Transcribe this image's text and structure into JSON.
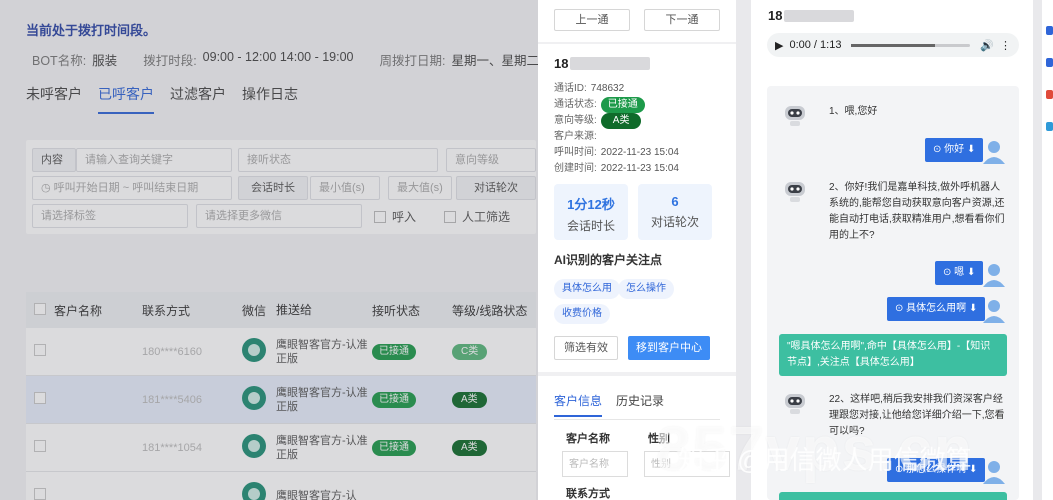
{
  "background": {
    "notice": "当前处于拨打时间段。",
    "meta": [
      {
        "k": "BOT名称:",
        "v": "服装"
      },
      {
        "k": "拨打时段:",
        "v": "09:00 - 12:00 14:00 - 19:00"
      },
      {
        "k": "周拨打日期:",
        "v": "星期一、星期二、星期三"
      }
    ],
    "tabs": [
      "未呼客户",
      "已呼客户",
      "过滤客户",
      "操作日志"
    ],
    "filters": {
      "content_label": "内容",
      "keyword_placeholder": "请输入查询关键字",
      "status_placeholder": "接听状态",
      "intent_placeholder": "意向等级",
      "start_date": "呼叫开始日期",
      "end_date": "呼叫结束日期",
      "duration_label": "会话时长",
      "min_placeholder": "最小值(s)",
      "max_placeholder": "最大值(s)",
      "rounds_label": "对话轮次",
      "tag_placeholder": "请选择标签",
      "wechat_placeholder": "请选择更多微信",
      "inbound_label": "呼入",
      "manual_label": "人工筛选"
    },
    "columns": [
      "客户名称",
      "联系方式",
      "微信",
      "推送给",
      "接听状态",
      "等级/线路状态"
    ],
    "rows": [
      {
        "phone": "180****6160",
        "push": "鹰眼智客官方-认准正版",
        "status": "已接通",
        "level": "C类"
      },
      {
        "phone": "181****5406",
        "push": "鹰眼智客官方-认准正版",
        "status": "已接通",
        "level": "A类"
      },
      {
        "phone": "181****1054",
        "push": "鹰眼智客官方-认准正版",
        "status": "已接通",
        "level": "A类"
      },
      {
        "phone": "",
        "push": "鹰眼智客官方-认",
        "status": "",
        "level": ""
      }
    ]
  },
  "detail": {
    "prev": "上一通",
    "next": "下一通",
    "phone_prefix": "18",
    "call_id_label": "通话ID:",
    "call_id": "748632",
    "call_status_label": "通话状态:",
    "call_status": "已接通",
    "intent_label": "意向等级:",
    "intent": "A类",
    "source_label": "客户来源:",
    "call_time_label": "呼叫时间:",
    "call_time": "2022-11-23 15:04",
    "create_time_label": "创建时间:",
    "create_time": "2022-11-23 15:04",
    "duration_value": "1分12秒",
    "duration_label": "会话时长",
    "rounds_value": "6",
    "rounds_label": "对话轮次",
    "ai_title": "AI识别的客户关注点",
    "tags": [
      "具体怎么用",
      "怎么操作",
      "收费价格"
    ],
    "filter_btn": "筛选有效",
    "move_btn": "移到客户中心",
    "tabs": [
      "客户信息",
      "历史记录"
    ],
    "name_label": "客户名称",
    "name_placeholder": "客户名称",
    "gender_label": "性别",
    "gender_placeholder": "性别",
    "contact_label": "联系方式"
  },
  "conversation": {
    "phone_prefix": "18",
    "audio_time": "0:00 / 1:13",
    "messages": [
      {
        "role": "bot",
        "text": "1、喂,您好"
      },
      {
        "role": "user",
        "text": "你好"
      },
      {
        "role": "bot",
        "text": "2、你好!我们是嘉单科技,做外呼机器人系统的,能帮您自动获取意向客户资源,还能自动打电话,获取精准用户,想看看你们用的上不?"
      },
      {
        "role": "user",
        "text": "嗯"
      },
      {
        "role": "user",
        "text": "具体怎么用啊"
      },
      {
        "role": "hit",
        "text": "\"嗯具体怎么用啊\",命中【具体怎么用】-【知识节点】,关注点【具体怎么用】"
      },
      {
        "role": "bot",
        "text": "22、这样吧,稍后我安排我们资深客户经理跟您对接,让他给您详细介绍一下,您看可以吗?"
      },
      {
        "role": "user",
        "text": "那怎么操作啊"
      }
    ]
  },
  "watermark": {
    "big": "857vps.cn",
    "small": "知乎 @用信微人用信微算"
  },
  "colors": {
    "primary": "#2f65d8",
    "green_badge": "#1d9a4a",
    "hit_bg": "#3dbfa1",
    "user_msg_bg": "#2f6fe0"
  }
}
